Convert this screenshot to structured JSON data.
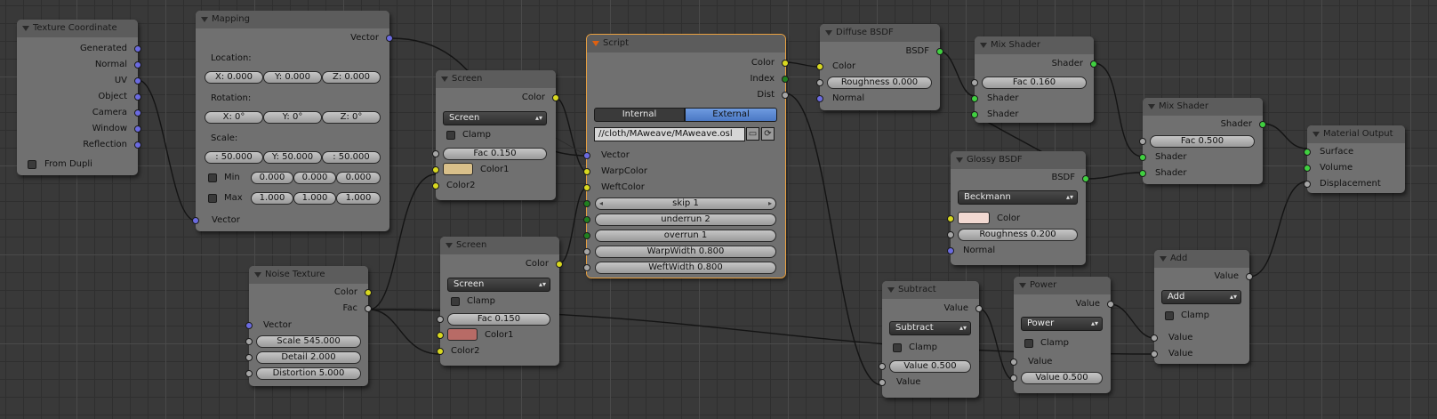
{
  "texcoord": {
    "title": "Texture Coordinate",
    "outputs": [
      "Generated",
      "Normal",
      "UV",
      "Object",
      "Camera",
      "Window",
      "Reflection"
    ],
    "from_dupli": "From Dupli"
  },
  "mapping": {
    "title": "Mapping",
    "out": "Vector",
    "location": "Location:",
    "loc": [
      "X: 0.000",
      "Y: 0.000",
      "Z: 0.000"
    ],
    "rotation": "Rotation:",
    "rot": [
      "X: 0°",
      "Y: 0°",
      "Z: 0°"
    ],
    "scale": "Scale:",
    "scl": [
      ": 50.000",
      "Y: 50.000",
      ": 50.000"
    ],
    "min": "Min",
    "min_v": [
      "0.000",
      "0.000",
      "0.000"
    ],
    "max": "Max",
    "max_v": [
      "1.000",
      "1.000",
      "1.000"
    ],
    "in": "Vector"
  },
  "screen1": {
    "title": "Screen",
    "out": "Color",
    "mode": "Screen",
    "clamp": "Clamp",
    "fac": "Fac 0.150",
    "color1": "Color1",
    "color2": "Color2",
    "swatch": "#d9c08a"
  },
  "screen2": {
    "title": "Screen",
    "out": "Color",
    "mode": "Screen",
    "clamp": "Clamp",
    "fac": "Fac 0.150",
    "color1": "Color1",
    "color2": "Color2",
    "swatch": "#b86b66"
  },
  "noise": {
    "title": "Noise Texture",
    "out_color": "Color",
    "out_fac": "Fac",
    "vector": "Vector",
    "scale": "Scale 545.000",
    "detail": "Detail 2.000",
    "distortion": "Distortion 5.000"
  },
  "script": {
    "title": "Script",
    "outputs": [
      "Color",
      "Index",
      "Dist"
    ],
    "internal": "Internal",
    "external": "External",
    "path": "//cloth/MAweave/MAweave.osl",
    "inputs": [
      "Vector",
      "WarpColor",
      "WeftColor"
    ],
    "fields": [
      "skip 1",
      "underrun 2",
      "overrun 1",
      "WarpWidth 0.800",
      "WeftWidth 0.800"
    ]
  },
  "diffuse": {
    "title": "Diffuse BSDF",
    "out": "BSDF",
    "color": "Color",
    "roughness": "Roughness 0.000",
    "normal": "Normal"
  },
  "mix1": {
    "title": "Mix Shader",
    "out": "Shader",
    "fac": "Fac 0.160",
    "sh1": "Shader",
    "sh2": "Shader"
  },
  "glossy": {
    "title": "Glossy BSDF",
    "out": "BSDF",
    "dist": "Beckmann",
    "color": "Color",
    "roughness": "Roughness 0.200",
    "normal": "Normal",
    "swatch": "#f2d9d2"
  },
  "mix2": {
    "title": "Mix Shader",
    "out": "Shader",
    "fac": "Fac 0.500",
    "sh1": "Shader",
    "sh2": "Shader"
  },
  "output": {
    "title": "Material Output",
    "inputs": [
      "Surface",
      "Volume",
      "Displacement"
    ]
  },
  "subtract": {
    "title": "Subtract",
    "out": "Value",
    "mode": "Subtract",
    "clamp": "Clamp",
    "value_field": "Value 0.500",
    "value": "Value"
  },
  "power": {
    "title": "Power",
    "out": "Value",
    "mode": "Power",
    "clamp": "Clamp",
    "value": "Value",
    "value_field": "Value 0.500"
  },
  "add": {
    "title": "Add",
    "out": "Value",
    "mode": "Add",
    "clamp": "Clamp",
    "v1": "Value",
    "v2": "Value"
  }
}
